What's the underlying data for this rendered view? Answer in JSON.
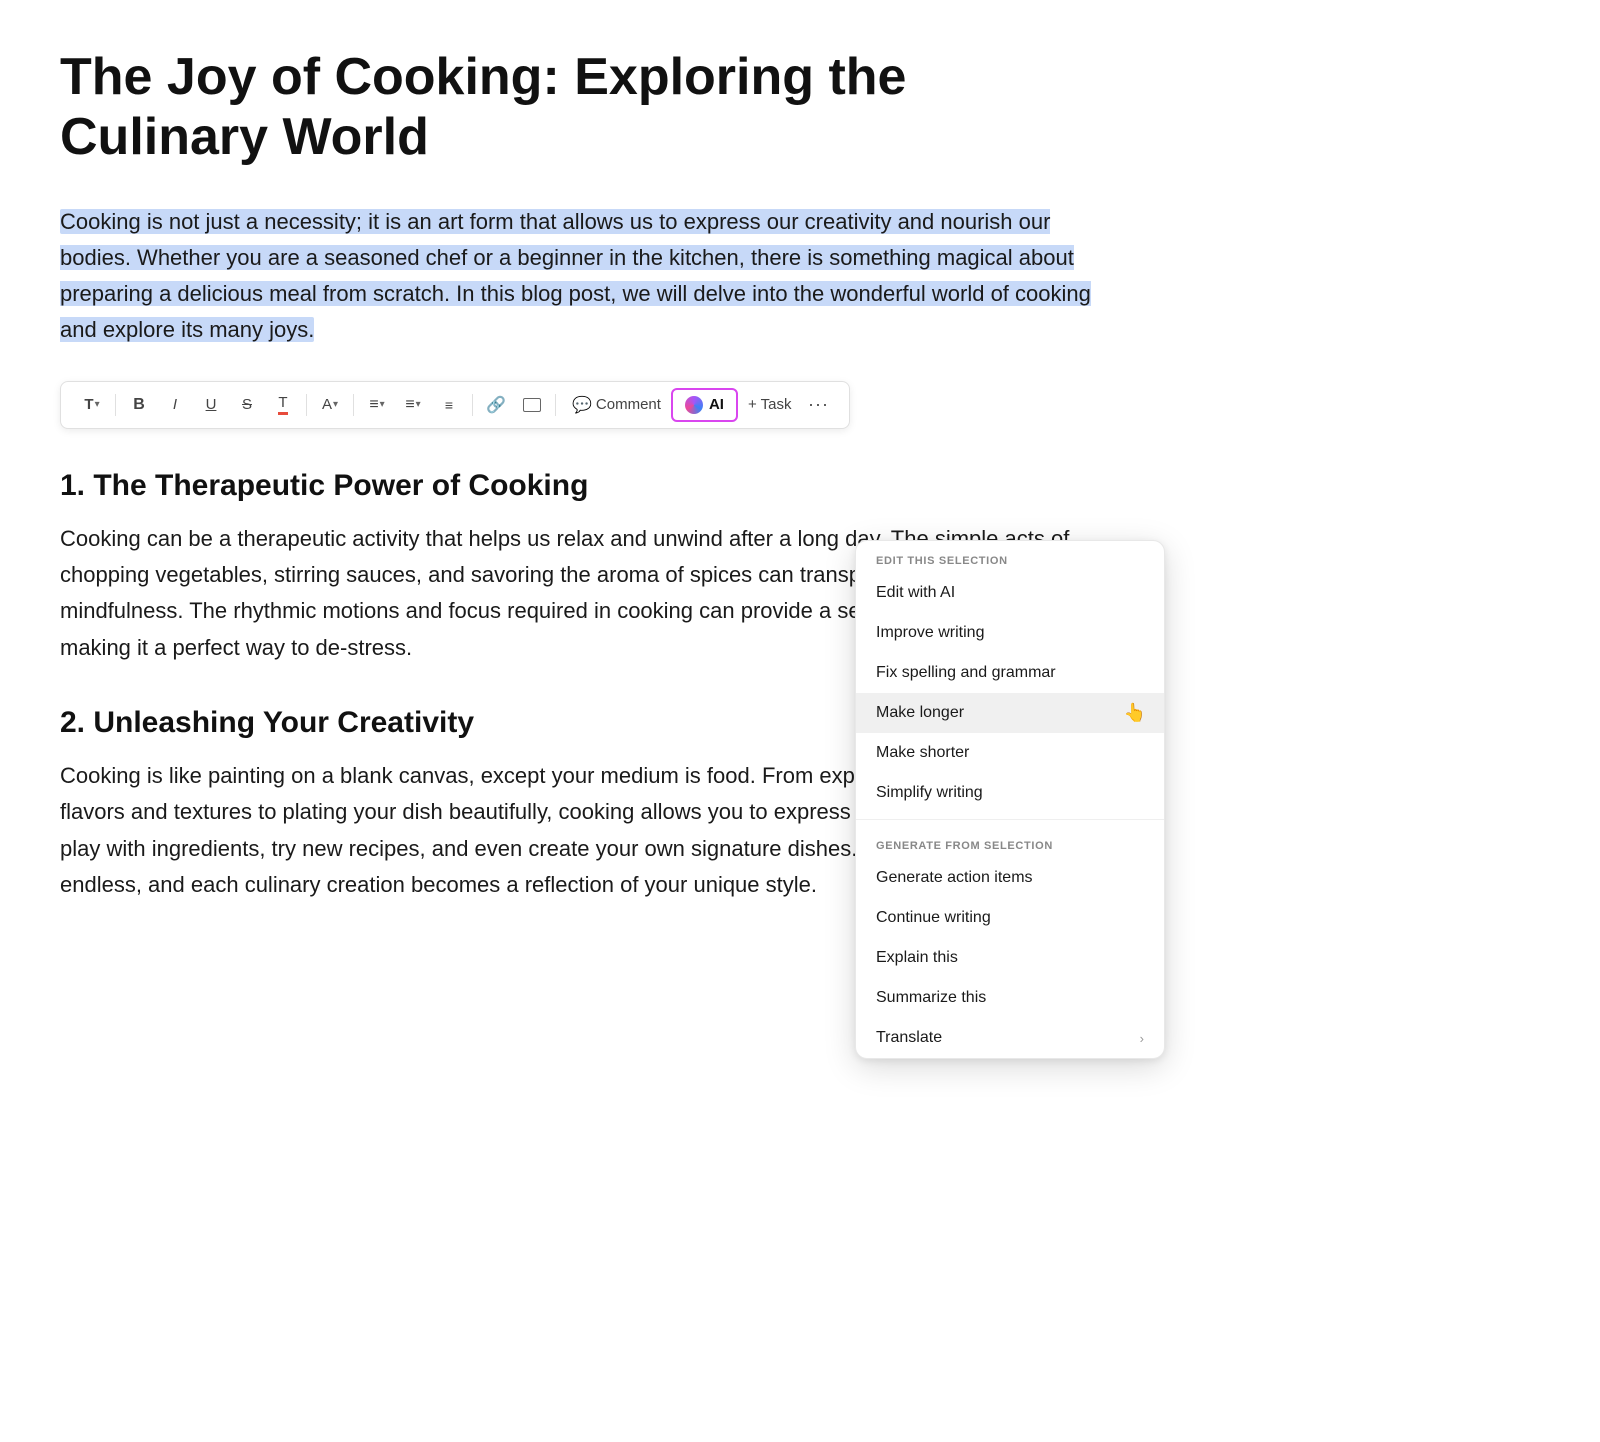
{
  "document": {
    "title": "The Joy of Cooking: Exploring the Culinary World",
    "selected_paragraph": "Cooking is not just a necessity; it is an art form that allows us to express our creativity and nourish our bodies. Whether you are a seasoned chef or a beginner in the kitchen, there is something magical about preparing a delicious meal from scratch. In this blog post, we will delve into the wonderful world of cooking and explore its many joys.",
    "section1": {
      "heading": "1. The Therapeutic Power of Cooking",
      "body": "Cooking can be a therapeutic activity that helps us relax and unwind after a long day. The simple acts of chopping vegetables, stirring sauces, and savoring the aroma of spices can transport us to a state of mindfulness. The rhythmic motions and focus required in cooking can provide a sense of fulfillment, making it a perfect way to de-stress."
    },
    "section2": {
      "heading": "2. Unleashing Your Creativity",
      "body": "Cooking is like painting on a blank canvas, except your medium is food. From experimenting with different flavors and textures to plating your dish beautifully, cooking allows you to express your creativity. You can play with ingredients, try new recipes, and even create your own signature dishes. The possibilities are endless, and each culinary creation becomes a reflection of your unique style."
    }
  },
  "toolbar": {
    "text_label": "T",
    "bold_label": "B",
    "italic_label": "I",
    "underline_label": "U",
    "strikethrough_label": "S",
    "text_color_label": "T",
    "font_label": "A",
    "align_label": "≡",
    "bullet_label": "≡",
    "indent_label": "≡",
    "link_label": "🔗",
    "media_label": "⬚",
    "comment_label": "Comment",
    "ai_label": "AI",
    "task_label": "+ Task",
    "more_label": "···"
  },
  "dropdown": {
    "edit_section_header": "EDIT THIS SELECTION",
    "generate_section_header": "GENERATE FROM SELECTION",
    "items_edit": [
      {
        "id": "edit-with-ai",
        "label": "Edit with AI",
        "has_arrow": false
      },
      {
        "id": "improve-writing",
        "label": "Improve writing",
        "has_arrow": false
      },
      {
        "id": "fix-spelling",
        "label": "Fix spelling and grammar",
        "has_arrow": false
      },
      {
        "id": "make-longer",
        "label": "Make longer",
        "has_arrow": false,
        "hovered": true
      },
      {
        "id": "make-shorter",
        "label": "Make shorter",
        "has_arrow": false
      },
      {
        "id": "simplify-writing",
        "label": "Simplify writing",
        "has_arrow": false
      }
    ],
    "items_generate": [
      {
        "id": "generate-action-items",
        "label": "Generate action items",
        "has_arrow": false
      },
      {
        "id": "continue-writing",
        "label": "Continue writing",
        "has_arrow": false
      },
      {
        "id": "explain-this",
        "label": "Explain this",
        "has_arrow": false
      },
      {
        "id": "summarize-this",
        "label": "Summarize this",
        "has_arrow": false
      },
      {
        "id": "translate",
        "label": "Translate",
        "has_arrow": true
      }
    ]
  }
}
